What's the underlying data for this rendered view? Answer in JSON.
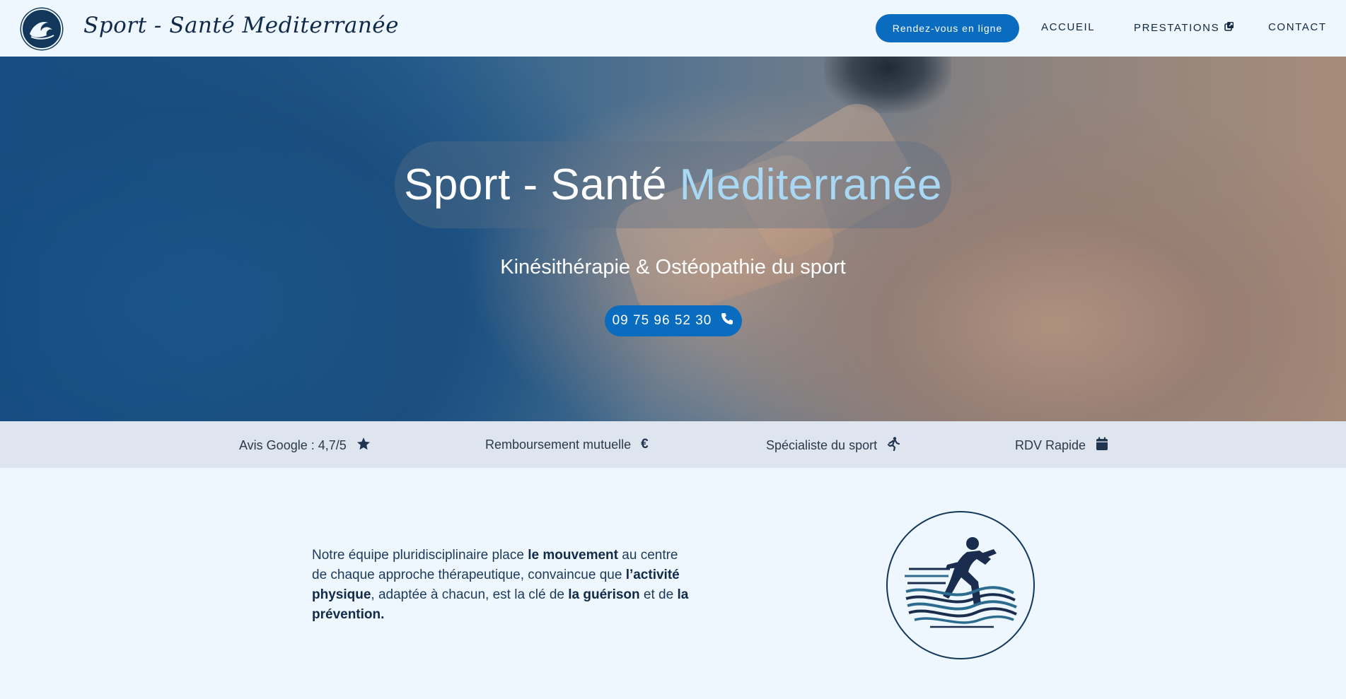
{
  "header": {
    "brand": "Sport - Santé Mediterranée",
    "rdv_button": "Rendez-vous en ligne",
    "nav": {
      "accueil": "ACCUEIL",
      "prestations": "PRESTATIONS",
      "contact": "CONTACT"
    }
  },
  "hero": {
    "title_part1": "Sport - Santé ",
    "title_part2": "Mediterranée",
    "subtitle": "Kinésithérapie & Ostéopathie du sport",
    "phone": "09 75 96 52 30"
  },
  "features": [
    {
      "label": "Avis Google : 4,7/5",
      "icon": "star-icon"
    },
    {
      "label": "Remboursement mutuelle",
      "icon": "euro-icon"
    },
    {
      "label": "Spécialiste du sport",
      "icon": "running-icon"
    },
    {
      "label": "RDV Rapide",
      "icon": "calendar-icon"
    }
  ],
  "intro": {
    "t1": "Notre équipe pluridisciplinaire place ",
    "b1": "le mouvement",
    "t2": " au centre de chaque approche thérapeutique, convaincue que ",
    "b2": "l’activité physique",
    "t3": ", adaptée à chacun, est la clé de ",
    "b3": "la guérison",
    "t4": " et de ",
    "b4": "la prévention."
  },
  "colors": {
    "accent_blue": "#0a6cbf",
    "title_accent": "#a9d8f5",
    "dark_navy": "#12375b",
    "background": "#eef7fd",
    "feature_bar": "#dfe5ee"
  }
}
